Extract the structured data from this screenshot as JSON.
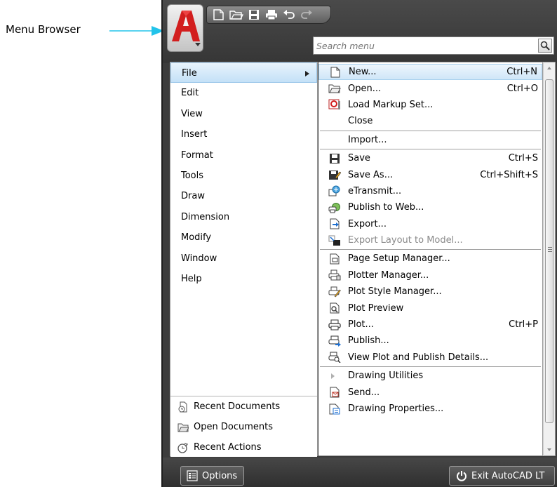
{
  "callout": {
    "label": "Menu Browser"
  },
  "search": {
    "placeholder": "Search menu"
  },
  "categories": [
    {
      "label": "File",
      "selected": true
    },
    {
      "label": "Edit"
    },
    {
      "label": "View"
    },
    {
      "label": "Insert"
    },
    {
      "label": "Format"
    },
    {
      "label": "Tools"
    },
    {
      "label": "Draw"
    },
    {
      "label": "Dimension"
    },
    {
      "label": "Modify"
    },
    {
      "label": "Window"
    },
    {
      "label": "Help"
    }
  ],
  "bottom_links": [
    {
      "label": "Recent Documents"
    },
    {
      "label": "Open Documents"
    },
    {
      "label": "Recent Actions"
    }
  ],
  "commands": {
    "new": {
      "label": "New...",
      "shortcut": "Ctrl+N"
    },
    "open": {
      "label": "Open...",
      "shortcut": "Ctrl+O"
    },
    "load_markup": {
      "label": "Load Markup Set..."
    },
    "close": {
      "label": "Close"
    },
    "import": {
      "label": "Import..."
    },
    "save": {
      "label": "Save",
      "shortcut": "Ctrl+S"
    },
    "save_as": {
      "label": "Save As...",
      "shortcut": "Ctrl+Shift+S"
    },
    "etransmit": {
      "label": "eTransmit..."
    },
    "publish_web": {
      "label": "Publish to Web..."
    },
    "export": {
      "label": "Export..."
    },
    "export_layout": {
      "label": "Export Layout to Model..."
    },
    "page_setup": {
      "label": "Page Setup Manager..."
    },
    "plotter_manager": {
      "label": "Plotter Manager..."
    },
    "plot_style": {
      "label": "Plot Style Manager..."
    },
    "plot_preview": {
      "label": "Plot Preview"
    },
    "plot": {
      "label": "Plot...",
      "shortcut": "Ctrl+P"
    },
    "publish": {
      "label": "Publish..."
    },
    "view_plot": {
      "label": "View Plot and Publish Details..."
    },
    "drawing_utilities": {
      "label": "Drawing Utilities"
    },
    "send": {
      "label": "Send..."
    },
    "drawing_properties": {
      "label": "Drawing Properties..."
    }
  },
  "footer": {
    "options_label": "Options",
    "exit_label": "Exit AutoCAD LT"
  },
  "colors": {
    "frame": "#3c3c3c",
    "selection": "#c4e1f7",
    "callout_arrow": "#22c3ea",
    "brand_red": "#d21e1e"
  }
}
